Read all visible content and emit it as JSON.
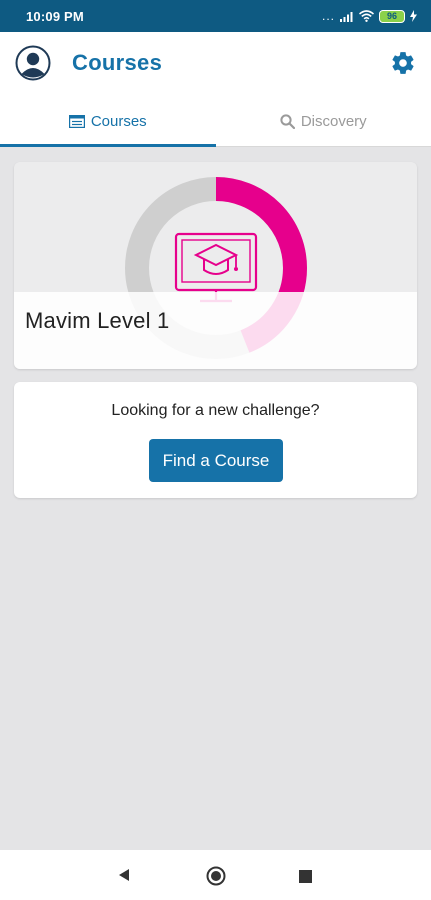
{
  "status_bar": {
    "time": "10:09 PM",
    "signal_dots": "...",
    "battery_level": "96"
  },
  "header": {
    "title": "Courses",
    "avatar_icon": "user-avatar-icon",
    "settings_icon": "gear-icon"
  },
  "tabs": [
    {
      "label": "Courses",
      "icon": "book-icon",
      "active": true
    },
    {
      "label": "Discovery",
      "icon": "search-icon",
      "active": false
    }
  ],
  "course": {
    "title": "Mavim Level 1",
    "progress_fraction": 0.44,
    "icon": "graduation-monitor-icon"
  },
  "challenge": {
    "prompt": "Looking for a new challenge?",
    "button_label": "Find a Course"
  },
  "colors": {
    "brand_blue": "#1672a8",
    "status_bar": "#0e5a82",
    "accent_magenta": "#e6008c",
    "ring_track": "#cfcfcf",
    "background": "#e4e4e6"
  }
}
